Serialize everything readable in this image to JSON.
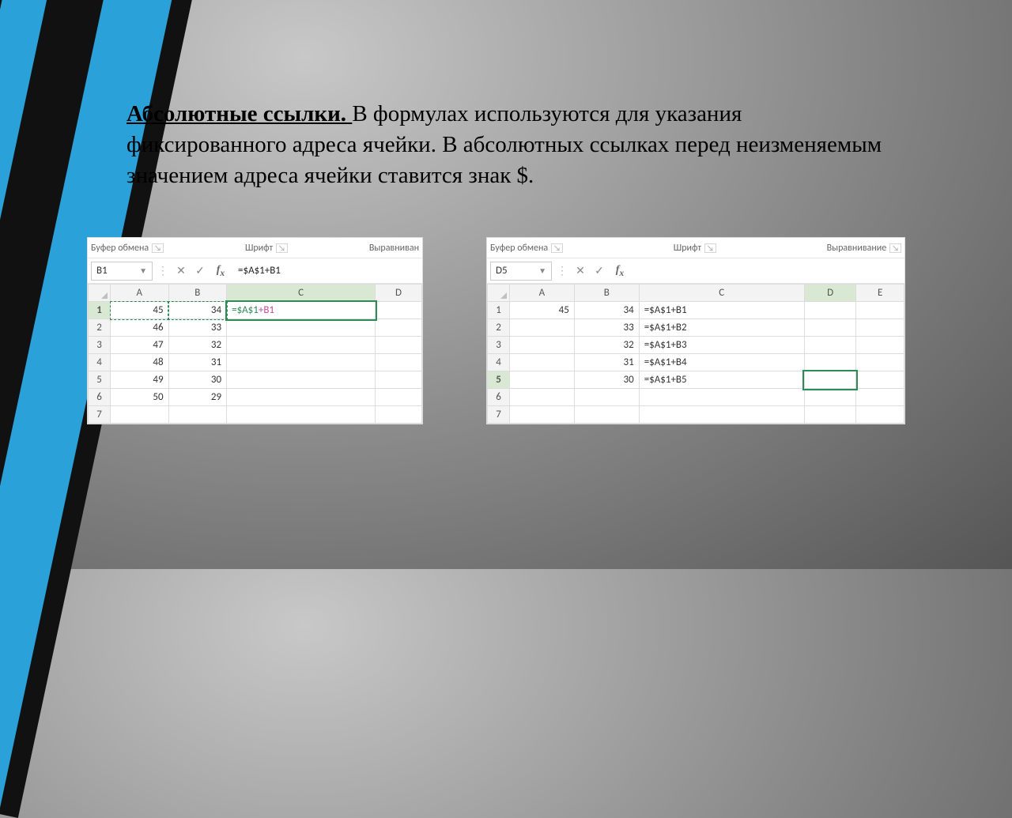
{
  "text": {
    "title": "Абсолютные ссылки. ",
    "body": "В формулах используются для указания фиксированного адреса ячейки. В абсолютных ссылках перед неизменяемым значением адреса ячейки ставится знак $."
  },
  "ribbon": {
    "clipboard": "Буфер обмена",
    "font": "Шрифт",
    "alignment_short": "Выравниван",
    "alignment": "Выравнивание"
  },
  "left": {
    "namebox": "B1",
    "formula": "=$A$1+B1",
    "edit_abs": "=$A$1",
    "edit_rel": "+B1",
    "columns": [
      "A",
      "B",
      "C",
      "D"
    ],
    "rows": [
      {
        "n": "1",
        "A": "45",
        "B": "34",
        "C": "",
        "D": ""
      },
      {
        "n": "2",
        "A": "46",
        "B": "33",
        "C": "",
        "D": ""
      },
      {
        "n": "3",
        "A": "47",
        "B": "32",
        "C": "",
        "D": ""
      },
      {
        "n": "4",
        "A": "48",
        "B": "31",
        "C": "",
        "D": ""
      },
      {
        "n": "5",
        "A": "49",
        "B": "30",
        "C": "",
        "D": ""
      },
      {
        "n": "6",
        "A": "50",
        "B": "29",
        "C": "",
        "D": ""
      },
      {
        "n": "7",
        "A": "",
        "B": "",
        "C": "",
        "D": ""
      }
    ]
  },
  "right": {
    "namebox": "D5",
    "formula": "",
    "columns": [
      "A",
      "B",
      "C",
      "D",
      "E"
    ],
    "rows": [
      {
        "n": "1",
        "A": "45",
        "B": "34",
        "C": "=$A$1+B1",
        "D": "",
        "E": ""
      },
      {
        "n": "2",
        "A": "",
        "B": "33",
        "C": "=$A$1+B2",
        "D": "",
        "E": ""
      },
      {
        "n": "3",
        "A": "",
        "B": "32",
        "C": "=$A$1+B3",
        "D": "",
        "E": ""
      },
      {
        "n": "4",
        "A": "",
        "B": "31",
        "C": "=$A$1+B4",
        "D": "",
        "E": ""
      },
      {
        "n": "5",
        "A": "",
        "B": "30",
        "C": "=$A$1+B5",
        "D": "",
        "E": ""
      },
      {
        "n": "6",
        "A": "",
        "B": "",
        "C": "",
        "D": "",
        "E": ""
      },
      {
        "n": "7",
        "A": "",
        "B": "",
        "C": "",
        "D": "",
        "E": ""
      }
    ]
  }
}
